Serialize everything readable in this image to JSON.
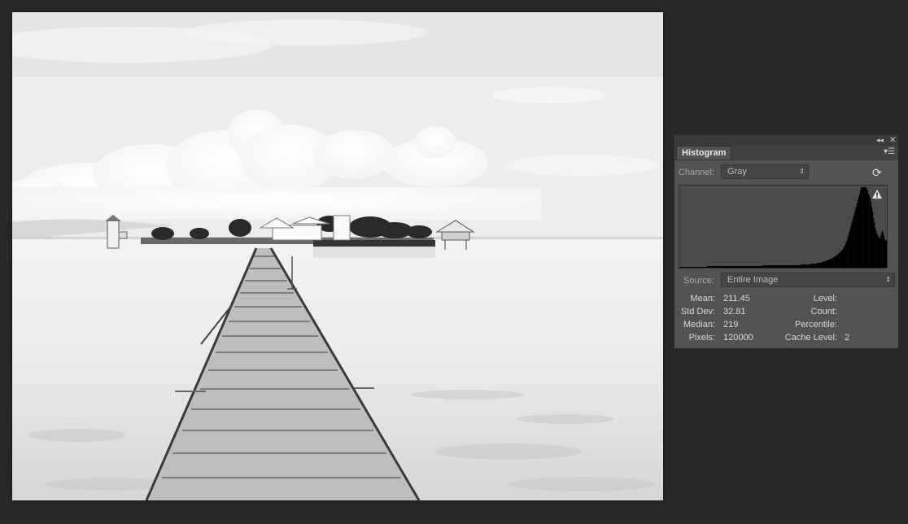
{
  "panel": {
    "tab_label": "Histogram",
    "channel_label": "Channel:",
    "channel_value": "Gray",
    "source_label": "Source:",
    "source_value": "Entire Image",
    "stats": {
      "mean_label": "Mean:",
      "mean_value": "211.45",
      "stddev_label": "Std Dev:",
      "stddev_value": "32.81",
      "median_label": "Median:",
      "median_value": "219",
      "pixels_label": "Pixels:",
      "pixels_value": "120000",
      "level_label": "Level:",
      "level_value": "",
      "count_label": "Count:",
      "count_value": "",
      "percentile_label": "Percentile:",
      "percentile_value": "",
      "cache_label": "Cache Level:",
      "cache_value": "2"
    }
  },
  "icons": {
    "collapse": "double-chevron-left-icon",
    "close": "close-icon",
    "panel_menu": "panel-menu-icon",
    "refresh": "refresh-icon",
    "warning": "warning-icon",
    "dropdown_arrow": "updown-arrows-icon"
  },
  "colors": {
    "app_bg": "#282828",
    "panel_bg": "#535353",
    "histogram_fill": "#000000"
  },
  "histogram_levels": [
    0.01,
    0.01,
    0.01,
    0.01,
    0.01,
    0.01,
    0.01,
    0.01,
    0.01,
    0.01,
    0.01,
    0.01,
    0.01,
    0.01,
    0.01,
    0.01,
    0.01,
    0.01,
    0.01,
    0.01,
    0.01,
    0.01,
    0.01,
    0.01,
    0.01,
    0.01,
    0.01,
    0.01,
    0.01,
    0.01,
    0.01,
    0.01,
    0.02,
    0.02,
    0.02,
    0.02,
    0.02,
    0.02,
    0.02,
    0.02,
    0.02,
    0.02,
    0.02,
    0.02,
    0.02,
    0.02,
    0.02,
    0.02,
    0.02,
    0.02,
    0.02,
    0.02,
    0.02,
    0.02,
    0.02,
    0.02,
    0.02,
    0.02,
    0.02,
    0.02,
    0.02,
    0.02,
    0.02,
    0.02,
    0.02,
    0.02,
    0.02,
    0.02,
    0.02,
    0.02,
    0.02,
    0.02,
    0.02,
    0.02,
    0.02,
    0.02,
    0.02,
    0.02,
    0.02,
    0.02,
    0.02,
    0.02,
    0.02,
    0.02,
    0.02,
    0.02,
    0.02,
    0.02,
    0.02,
    0.02,
    0.02,
    0.02,
    0.02,
    0.02,
    0.02,
    0.02,
    0.03,
    0.03,
    0.03,
    0.03,
    0.03,
    0.03,
    0.03,
    0.03,
    0.03,
    0.03,
    0.03,
    0.03,
    0.03,
    0.03,
    0.03,
    0.03,
    0.03,
    0.03,
    0.03,
    0.03,
    0.03,
    0.03,
    0.03,
    0.03,
    0.03,
    0.03,
    0.03,
    0.03,
    0.03,
    0.03,
    0.03,
    0.03,
    0.03,
    0.03,
    0.03,
    0.03,
    0.03,
    0.03,
    0.03,
    0.03,
    0.03,
    0.03,
    0.03,
    0.03,
    0.04,
    0.04,
    0.04,
    0.04,
    0.04,
    0.04,
    0.04,
    0.04,
    0.04,
    0.04,
    0.04,
    0.05,
    0.05,
    0.05,
    0.05,
    0.05,
    0.05,
    0.05,
    0.05,
    0.06,
    0.06,
    0.06,
    0.06,
    0.06,
    0.07,
    0.07,
    0.07,
    0.08,
    0.08,
    0.08,
    0.09,
    0.09,
    0.1,
    0.1,
    0.11,
    0.11,
    0.12,
    0.12,
    0.13,
    0.14,
    0.14,
    0.15,
    0.16,
    0.17,
    0.18,
    0.19,
    0.2,
    0.21,
    0.22,
    0.24,
    0.26,
    0.28,
    0.3,
    0.33,
    0.36,
    0.4,
    0.44,
    0.48,
    0.52,
    0.56,
    0.6,
    0.64,
    0.68,
    0.72,
    0.76,
    0.8,
    0.84,
    0.88,
    0.92,
    0.96,
    1.0,
    1.0,
    1.0,
    1.0,
    1.0,
    1.0,
    0.98,
    0.96,
    0.92,
    0.9,
    0.86,
    0.82,
    0.76,
    0.7,
    0.62,
    0.56,
    0.5,
    0.46,
    0.42,
    0.4,
    0.38,
    0.36,
    0.38,
    0.42,
    0.46,
    0.44,
    0.4,
    0.36,
    0.34,
    0.34
  ]
}
